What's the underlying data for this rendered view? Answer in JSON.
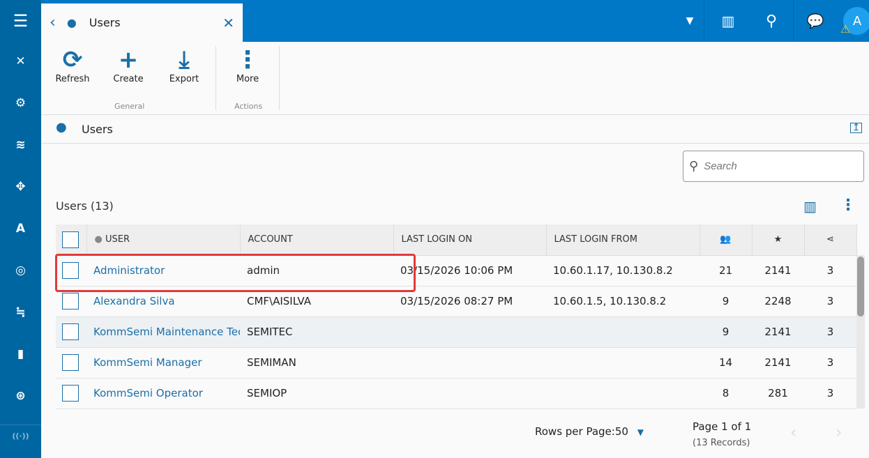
{
  "tab": {
    "title": "Users"
  },
  "ribbon": {
    "buttons": [
      {
        "label": "Refresh"
      },
      {
        "label": "Create"
      },
      {
        "label": "Export"
      },
      {
        "label": "More"
      }
    ],
    "groups": [
      "General",
      "Actions"
    ]
  },
  "section": {
    "title": "Users"
  },
  "search": {
    "placeholder": "Search",
    "value": ""
  },
  "list": {
    "title": "Users (13)"
  },
  "avatar": {
    "initial": "A"
  },
  "table": {
    "columns": [
      "USER",
      "ACCOUNT",
      "LAST LOGIN ON",
      "LAST LOGIN FROM"
    ],
    "rows": [
      {
        "user": "Administrator",
        "account": "admin",
        "last_login_on": "03/15/2026 10:06 PM",
        "last_login_from": "10.60.1.17, 10.130.8.2",
        "groups": "21",
        "favorites": "2141",
        "shared": "3"
      },
      {
        "user": "Alexandra Silva",
        "account": "CMF\\AISILVA",
        "last_login_on": "03/15/2026 08:27 PM",
        "last_login_from": "10.60.1.5, 10.130.8.2",
        "groups": "9",
        "favorites": "2248",
        "shared": "3"
      },
      {
        "user": "KommSemi Maintenance Technician",
        "account": "SEMITEC",
        "last_login_on": "",
        "last_login_from": "",
        "groups": "9",
        "favorites": "2141",
        "shared": "3"
      },
      {
        "user": "KommSemi Manager",
        "account": "SEMIMAN",
        "last_login_on": "",
        "last_login_from": "",
        "groups": "14",
        "favorites": "2141",
        "shared": "3"
      },
      {
        "user": "KommSemi Operator",
        "account": "SEMIOP",
        "last_login_on": "",
        "last_login_from": "",
        "groups": "8",
        "favorites": "281",
        "shared": "3"
      }
    ]
  },
  "footer": {
    "rows_per_page": "Rows per Page:50",
    "page": "Page 1 of 1",
    "records": "(13 Records)"
  },
  "colors": {
    "sidebar": "#0066a1",
    "topbar": "#0078c6",
    "link": "#1a6fa8",
    "highlight": "#e03a3a"
  }
}
